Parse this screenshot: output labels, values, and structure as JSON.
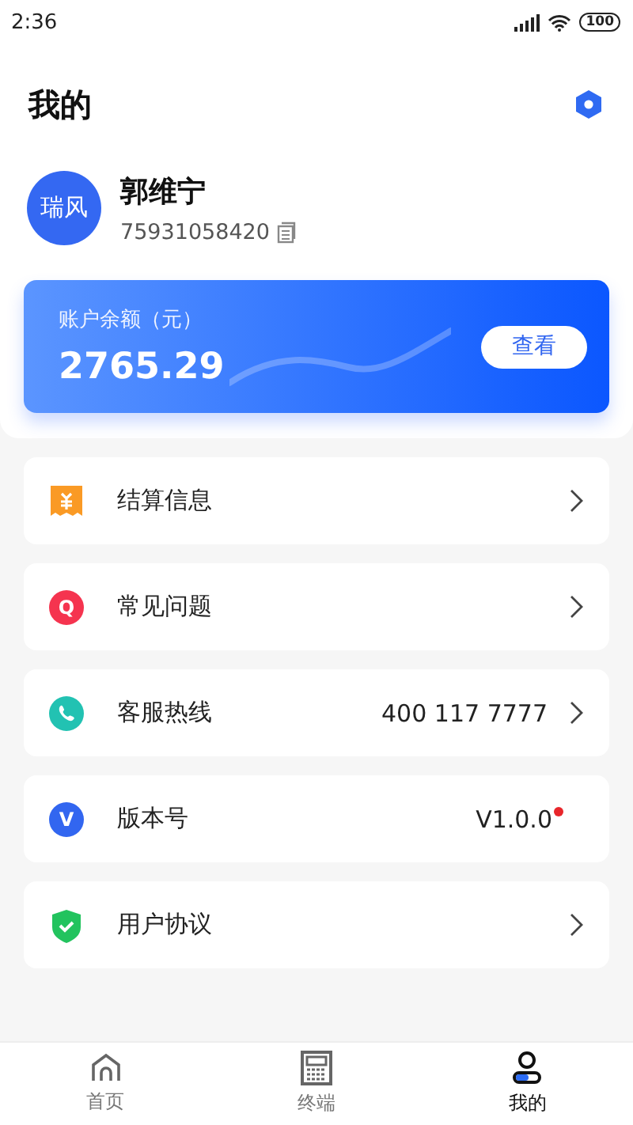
{
  "status_bar": {
    "time": "2:36",
    "battery": "100"
  },
  "header": {
    "title": "我的"
  },
  "profile": {
    "avatar_text": "瑞风",
    "name": "郭维宁",
    "account": "75931058420"
  },
  "balance": {
    "label": "账户余额（元）",
    "amount": "2765.29",
    "button": "查看"
  },
  "menu": [
    {
      "kind": "receipt",
      "label": "结算信息",
      "arrow": true
    },
    {
      "kind": "letter",
      "icon_text": "Q",
      "color": "#f5344f",
      "label": "常见问题",
      "arrow": true
    },
    {
      "kind": "phone",
      "label": "客服热线",
      "value": "400 117 7777",
      "arrow": true
    },
    {
      "kind": "letter",
      "icon_text": "V",
      "color": "#3266f0",
      "label": "版本号",
      "value": "V1.0.0",
      "dot": true,
      "arrow": false
    },
    {
      "kind": "shield",
      "label": "用户协议",
      "arrow": true
    }
  ],
  "tabs": [
    {
      "kind": "home",
      "label": "首页",
      "selected": false
    },
    {
      "kind": "terminal",
      "label": "终端",
      "selected": false
    },
    {
      "kind": "person",
      "label": "我的",
      "selected": true
    }
  ]
}
